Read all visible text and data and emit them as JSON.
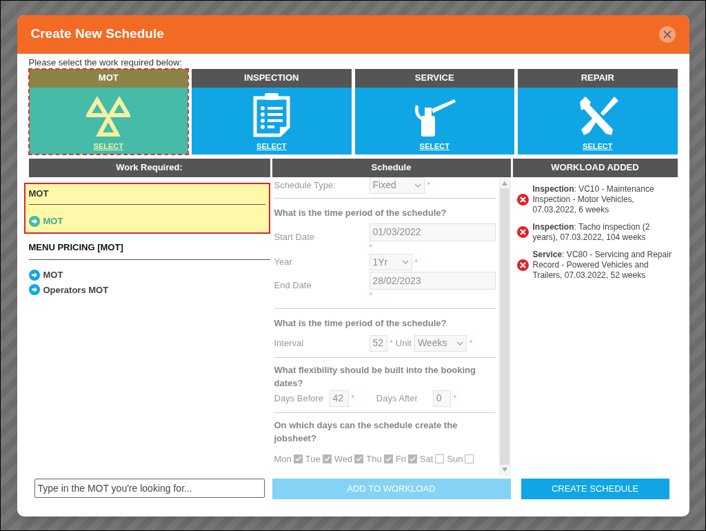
{
  "dialog": {
    "title": "Create New Schedule"
  },
  "instruction": "Please select the work required below:",
  "work_types": [
    {
      "kind": "mot",
      "label": "MOT",
      "action": "SELECT",
      "selected": true
    },
    {
      "kind": "inspection",
      "label": "INSPECTION",
      "action": "SELECT",
      "selected": false
    },
    {
      "kind": "service",
      "label": "SERVICE",
      "action": "SELECT",
      "selected": false
    },
    {
      "kind": "repair",
      "label": "REPAIR",
      "action": "SELECT",
      "selected": false
    }
  ],
  "work_required": {
    "heading": "Work Required:",
    "selected_group": {
      "title": "MOT",
      "items": [
        "MOT"
      ]
    },
    "menu_pricing": {
      "title": "MENU PRICING [MOT]",
      "items": [
        "MOT",
        "Operators MOT"
      ]
    }
  },
  "schedule": {
    "heading": "Schedule",
    "disabled": true,
    "required_mark": "*",
    "schedule_type": {
      "label": "Schedule Type:",
      "value": "Fixed"
    },
    "period_question": "What is the time period of the schedule?",
    "start_date": {
      "label": "Start Date",
      "value": "01/03/2022"
    },
    "year": {
      "label": "Year",
      "value": "1Yr"
    },
    "end_date": {
      "label": "End Date",
      "value": "28/02/2023"
    },
    "interval_question": "What is the time period of the schedule?",
    "interval": {
      "label": "Interval",
      "value": "52"
    },
    "unit": {
      "label": "Unit",
      "value": "Weeks"
    },
    "flex_question": "What flexibility should be built into the booking dates?",
    "days_before": {
      "label": "Days Before",
      "value": "42"
    },
    "days_after": {
      "label": "Days After",
      "value": "0"
    },
    "days_question": "On which days can the schedule create the jobsheet?",
    "days": [
      {
        "label": "Mon",
        "checked": true
      },
      {
        "label": "Tue",
        "checked": true
      },
      {
        "label": "Wed",
        "checked": true
      },
      {
        "label": "Thu",
        "checked": true
      },
      {
        "label": "Fri",
        "checked": true
      },
      {
        "label": "Sat",
        "checked": false
      },
      {
        "label": "Sun",
        "checked": false
      }
    ]
  },
  "workload": {
    "heading": "WORKLOAD ADDED",
    "items": [
      "**Inspection**: VC10 - Maintenance Inspection - Motor Vehicles, 07.03.2022, 6 weeks",
      "**Inspection**: Tacho inspection (2 years), 07.03.2022, 104 weeks",
      "**Service**: VC80 - Servicing and Repair Record - Powered Vehicles and Trailers, 07.03.2022, 52 weeks"
    ]
  },
  "search": {
    "placeholder": "Type in the MOT you're looking for..."
  },
  "buttons": [
    {
      "label": "ADD TO WORKLOAD",
      "disabled": true
    },
    {
      "label": "CREATE SCHEDULE",
      "disabled": false
    }
  ]
}
